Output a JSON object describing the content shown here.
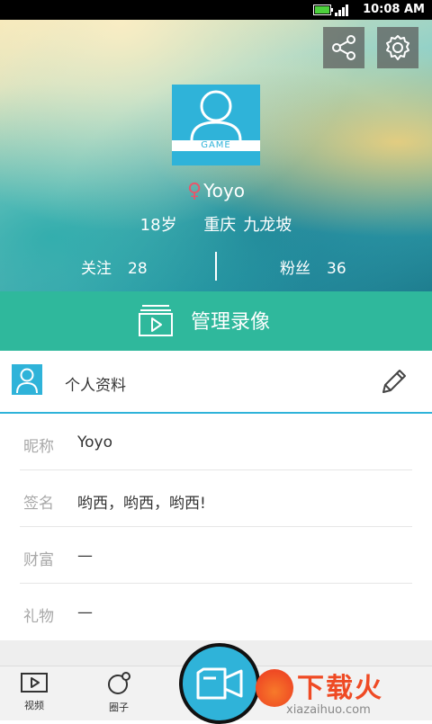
{
  "status_bar": {
    "time": "10:08 AM"
  },
  "header": {
    "avatar_badge": "GAME",
    "gender_symbol": "♀",
    "username": "Yoyo",
    "age": "18岁",
    "city": "重庆",
    "district": "九龙坡",
    "following_label": "关注",
    "following_count": "28",
    "fans_label": "粉丝",
    "fans_count": "36"
  },
  "manage": {
    "label": "管理录像"
  },
  "profile": {
    "title": "个人资料",
    "rows": [
      {
        "key": "昵称",
        "value": "Yoyo"
      },
      {
        "key": "签名",
        "value": "哟西，哟西，哟西!"
      },
      {
        "key": "财富",
        "value": "—"
      },
      {
        "key": "礼物",
        "value": "—"
      }
    ]
  },
  "bottom_nav": {
    "items": [
      {
        "label": "视频",
        "icon": "video-icon"
      },
      {
        "label": "圈子",
        "icon": "circle-icon"
      }
    ],
    "record_icon": "camera-icon"
  },
  "watermark": {
    "brand": "下载火",
    "site": "xiazaihuo.com"
  },
  "colors": {
    "accent_blue": "#2fb3d9",
    "accent_green": "#2fb89c",
    "gender_pink": "#e8566b",
    "watermark_orange": "#ef4a24"
  }
}
